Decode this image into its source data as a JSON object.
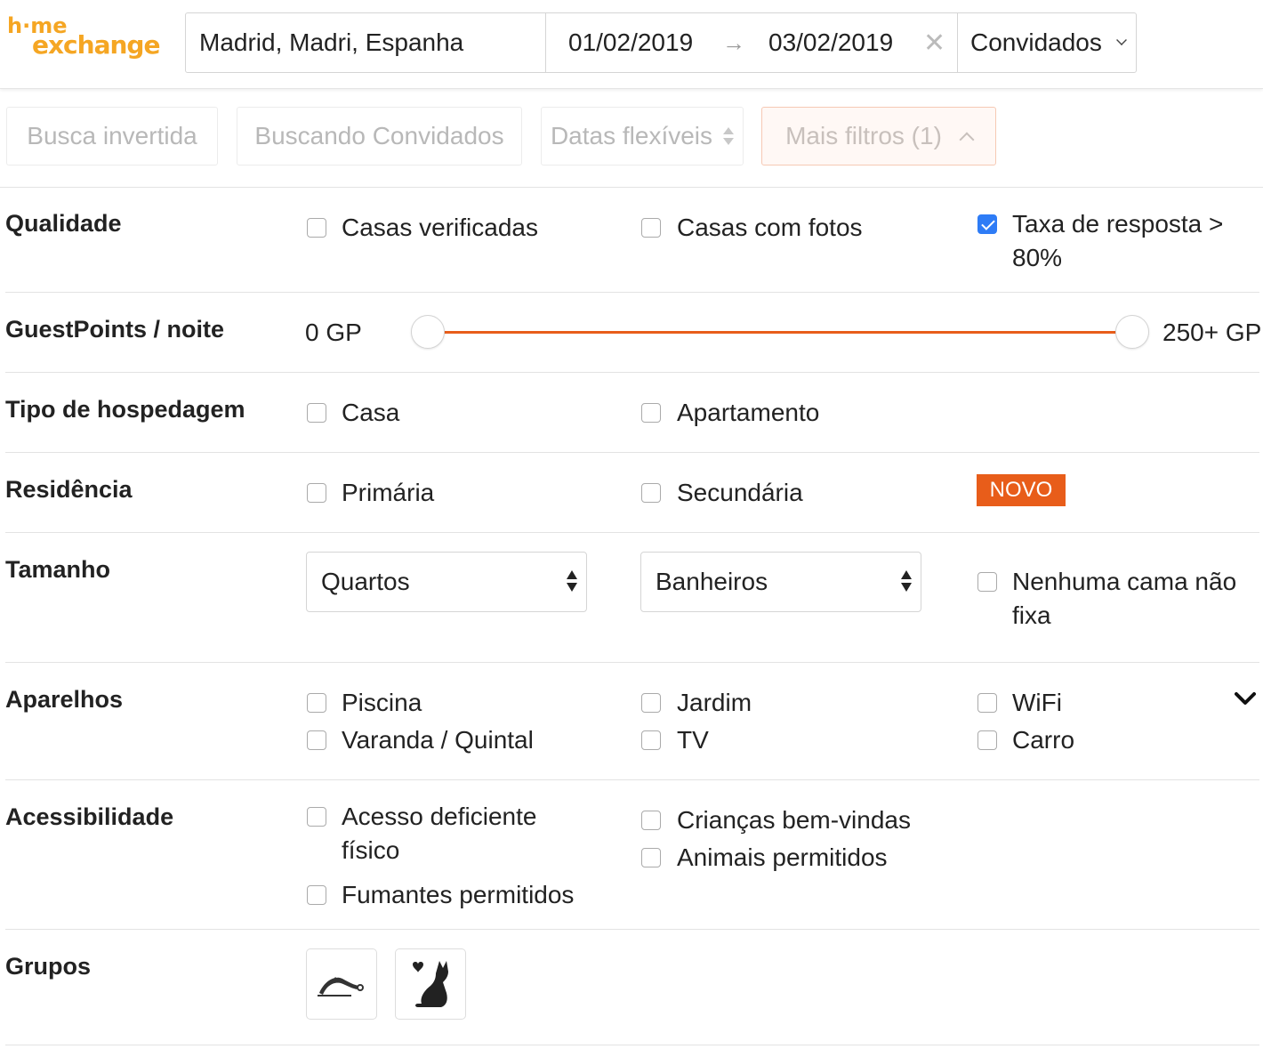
{
  "logo": {
    "line1": "h·me",
    "line2": "exchange"
  },
  "search": {
    "location": "Madrid, Madri, Espanha",
    "date_start": "01/02/2019",
    "date_end": "03/02/2019",
    "arrow": "→",
    "clear": "✕",
    "guests": "Convidados"
  },
  "filters": {
    "reverse": "Busca invertida",
    "searching_guests": "Buscando Convidados",
    "flexible_dates": "Datas flexíveis",
    "more_filters": "Mais filtros (1)"
  },
  "sections": {
    "quality": {
      "label": "Qualidade",
      "options": [
        "Casas verificadas",
        "Casas com fotos",
        "Taxa de resposta >",
        "80%"
      ],
      "checked": [
        false,
        false,
        true
      ]
    },
    "guestpoints": {
      "label": "GuestPoints / noite",
      "min_label": "0 GP",
      "max_label": "250+ GP",
      "min_value": 0,
      "max_value": 250
    },
    "type": {
      "label": "Tipo de hospedagem",
      "options": [
        "Casa",
        "Apartamento"
      ]
    },
    "residence": {
      "label": "Residência",
      "options": [
        "Primária",
        "Secundária"
      ],
      "badge": "NOVO"
    },
    "size": {
      "label": "Tamanho",
      "rooms": "Quartos",
      "bathrooms": "Banheiros",
      "no_bed": [
        "Nenhuma cama não",
        "fixa"
      ]
    },
    "amenities": {
      "label": "Aparelhos",
      "options": [
        "Piscina",
        "Varanda / Quintal",
        "Jardim",
        "TV",
        "WiFi",
        "Carro"
      ]
    },
    "accessibility": {
      "label": "Acessibilidade",
      "options": [
        "Acesso deficiente",
        "físico",
        "Fumantes permitidos",
        "Crianças bem-vindas",
        "Animais permitidos"
      ]
    },
    "groups": {
      "label": "Grupos"
    }
  },
  "colors": {
    "brand": "#f5a623",
    "accent": "#e85d1a",
    "check": "#2e7cf6"
  }
}
